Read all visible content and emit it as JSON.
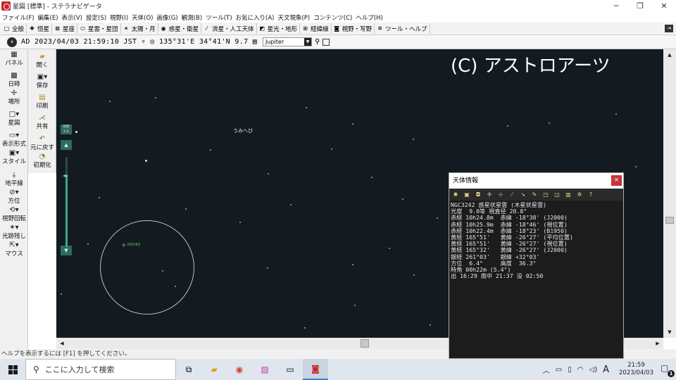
{
  "window": {
    "title": "星図 [標準] - ステラナビゲータ",
    "controls": [
      "minimize",
      "restore",
      "close"
    ]
  },
  "menubar": [
    "ファイル(F)",
    "編集(E)",
    "表示(V)",
    "設定(S)",
    "視野(I)",
    "天体(O)",
    "画像(G)",
    "観測(B)",
    "ツール(T)",
    "お気に入り(A)",
    "天文現象(P)",
    "コンテンツ(C)",
    "ヘルプ(H)"
  ],
  "toolbar1": [
    {
      "icon": "window-icon",
      "label": "全般"
    },
    {
      "icon": "star-cross-icon",
      "label": "恒星"
    },
    {
      "icon": "constellation-icon",
      "label": "星座"
    },
    {
      "icon": "galaxy-icon",
      "label": "星雲・星団"
    },
    {
      "icon": "sun-icon",
      "label": "太陽・月"
    },
    {
      "icon": "planet-icon",
      "label": "惑星・衛星"
    },
    {
      "icon": "comet-icon",
      "label": "流星・人工天体"
    },
    {
      "icon": "landscape-icon",
      "label": "星光・地形"
    },
    {
      "icon": "grid-icon",
      "label": "経緯線"
    },
    {
      "icon": "camera-icon",
      "label": "視野・写野"
    },
    {
      "icon": "gear-icon",
      "label": "ツール・ヘルプ"
    }
  ],
  "toolbar2": {
    "datetime": "AD 2023/04/03 21:59:10 JST",
    "location": "135°31'E 34°41'N",
    "magnitude": "9.7",
    "search_value": "Jupiter"
  },
  "left_panel": [
    {
      "icon": "panel-icon",
      "label": "パネル"
    },
    {
      "icon": "clock-icon",
      "label": "日時"
    },
    {
      "icon": "location-icon",
      "label": "場所"
    },
    {
      "icon": "starmap-icon",
      "label": "星図"
    },
    {
      "icon": "display-icon",
      "label": "表示形式"
    },
    {
      "icon": "style-icon",
      "label": "スタイル"
    },
    {
      "icon": "horizon-icon",
      "label": "地平線"
    },
    {
      "icon": "compass-icon",
      "label": "方位"
    },
    {
      "icon": "rotate-icon",
      "label": "視野回転"
    },
    {
      "icon": "trail-icon",
      "label": "光跡残し"
    },
    {
      "icon": "mouse-icon",
      "label": "マウス"
    }
  ],
  "left_panel2": [
    {
      "icon": "folder-open-icon",
      "label": "開く"
    },
    {
      "icon": "save-icon",
      "label": "保存"
    },
    {
      "icon": "print-icon",
      "label": "印刷"
    },
    {
      "icon": "share-icon",
      "label": "共有"
    },
    {
      "icon": "undo-icon",
      "label": "元に戻す"
    },
    {
      "icon": "reset-icon",
      "label": "初期化"
    }
  ],
  "sky": {
    "copyright": "(C) アストロアーツ",
    "constellation_label": "うみへび",
    "target_label": "N3242",
    "zoom_badge": "視野\n0.0",
    "zoom_level": 0.8
  },
  "status_text": "ヘルプを表示するには [F1] を押してください。",
  "info_panel": {
    "title": "天体情報",
    "lines": [
      "NGC3242 惑星状星雲 (木星状星雲)",
      "光度  9.0等 視直径 20.8\"",
      "赤経 10h24.8m  赤緯 -18°38' (J2000)",
      "赤経 10h25.9m  赤緯 -18°46' (視位置)",
      "赤経 10h22.4m  赤緯 -18°23' (B1950)",
      "黄経 165°51'   黄緯 -26°27' (平均位置)",
      "黄経 165°51'   黄緯 -26°27' (視位置)",
      "黄経 165°32'   黄緯 -26°27' (J2000)",
      "銀経 261°03'   銀緯 +32°03'",
      "方位  6.4°     高度  36.3°",
      "時角 00h22m (5.4°)",
      "出 16:29 南中 21:37 没 02:50"
    ]
  },
  "taskbar": {
    "search_placeholder": "ここに入力して検索",
    "ime": "A",
    "time": "21:59",
    "date": "2023/04/03",
    "notifications": "1"
  }
}
